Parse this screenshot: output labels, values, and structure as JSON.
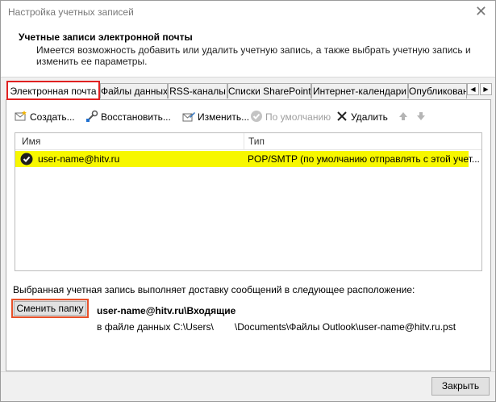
{
  "window": {
    "title": "Настройка учетных записей",
    "close_glyph": "✕"
  },
  "header": {
    "title": "Учетные записи электронной почты",
    "description": "Имеется возможность добавить или удалить учетную запись, а также выбрать учетную запись и изменить ее параметры."
  },
  "tabs": [
    {
      "label": "Электронная почта",
      "active": true
    },
    {
      "label": "Файлы данных"
    },
    {
      "label": "RSS-каналы"
    },
    {
      "label": "Списки SharePoint"
    },
    {
      "label": "Интернет-календари"
    },
    {
      "label": "Опубликованн"
    }
  ],
  "tab_scroll": {
    "left": "◀",
    "right": "▶"
  },
  "toolbar": {
    "create": "Создать...",
    "restore": "Восстановить...",
    "edit": "Изменить...",
    "default": "По умолчанию",
    "delete": "Удалить"
  },
  "accounts": {
    "columns": {
      "name": "Имя",
      "type": "Тип"
    },
    "rows": [
      {
        "name": "user-name@hitv.ru",
        "type": "POP/SMTP (по умолчанию отправлять с этой учет..."
      }
    ]
  },
  "delivery": {
    "info": "Выбранная учетная запись выполняет доставку сообщений в следующее расположение:",
    "change_folder": "Сменить папку",
    "location": "user-name@hitv.ru\\Входящие",
    "path_prefix": "в файле данных C:\\Users\\",
    "path_suffix": "\\Documents\\Файлы Outlook\\user-name@hitv.ru.pst"
  },
  "footer": {
    "close": "Закрыть"
  },
  "colors": {
    "highlight": "#f7f700",
    "tab_outline": "#e02121",
    "button_outline": "#e8512a"
  }
}
